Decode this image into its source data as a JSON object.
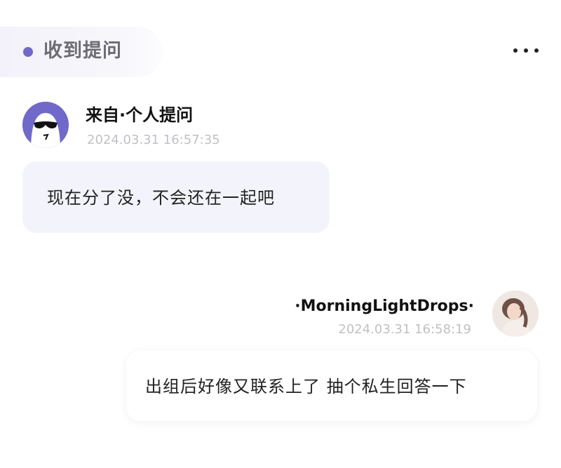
{
  "header": {
    "title": "收到提问",
    "more_icon": "more-horizontal-icon",
    "accent_color": "#7169c9"
  },
  "question": {
    "asker_label": "来自·个人提问",
    "timestamp": "2024.03.31 16:57:35",
    "text": "现在分了没，不会还在一起吧",
    "avatar_icon": "anonymous-sunglasses-avatar"
  },
  "answer": {
    "responder_name": "·MorningLightDrops·",
    "timestamp": "2024.03.31 16:58:19",
    "text": "出组后好像又联系上了 抽个私生回答一下",
    "avatar_icon": "user-photo-avatar"
  }
}
